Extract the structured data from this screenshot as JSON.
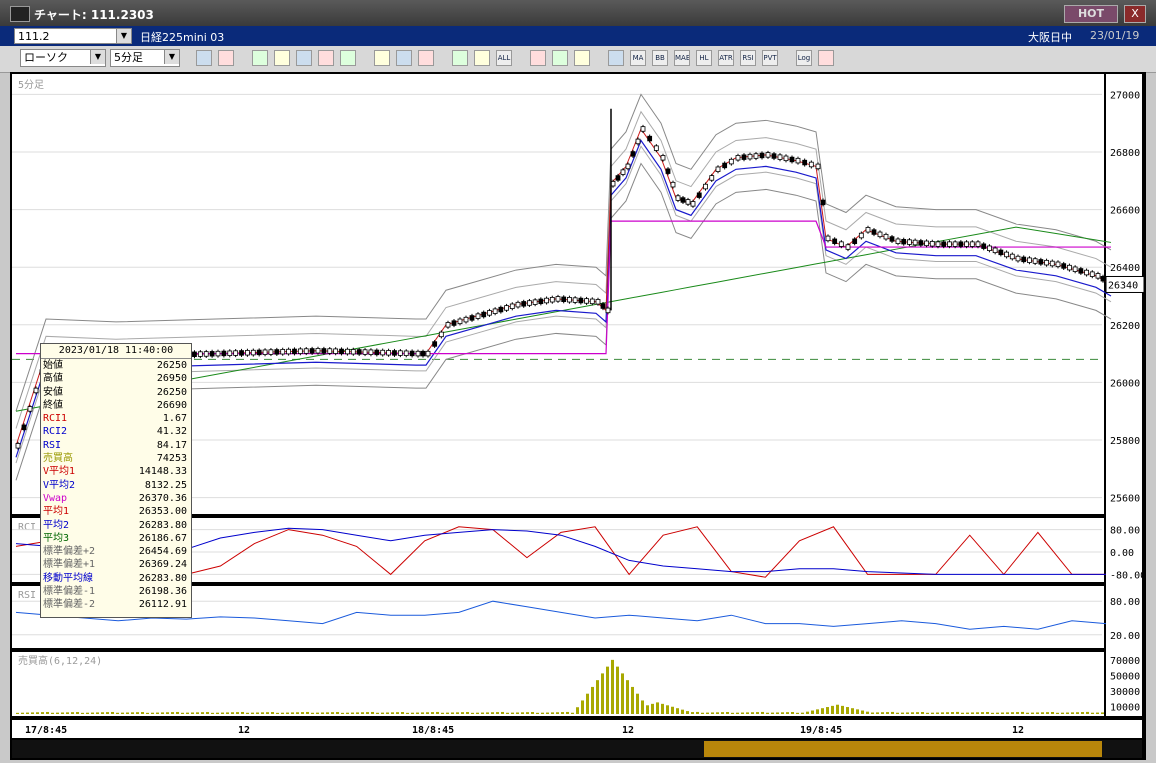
{
  "window": {
    "title": "チャート: 111.2303",
    "hot_label": "HOT",
    "close_label": "X"
  },
  "infobar": {
    "code": "111.2",
    "instrument": "日経225mini 03",
    "session": "大阪日中",
    "date": "23/01/19"
  },
  "toolbar": {
    "chart_type": "ローソク",
    "timeframe": "5分足",
    "buttons": [
      "zoom",
      "split",
      "buy-sell",
      "search",
      "bar",
      "indicator",
      "disabled",
      "draw",
      "cursor",
      "arrow",
      "candle",
      "line",
      "ALL",
      "pattern",
      "tools",
      "color",
      "band",
      "MA",
      "BB",
      "MAE",
      "HL",
      "ATR",
      "RSI",
      "PVT",
      "Log",
      "print"
    ],
    "text_buttons": {
      "MA": "MA",
      "BB": "BB",
      "MAE": "MAE",
      "HL": "HL",
      "ATR": "ATR",
      "RSI": "RSI",
      "PVT": "PVT",
      "Log": "Log",
      "ALL": "ALL"
    }
  },
  "panels": {
    "main_label": "5分足",
    "rci_label": "RCI",
    "rsi_label": "RSI",
    "volume_label": "売買高(6,12,24)"
  },
  "price_axis": {
    "ticks": [
      "27000",
      "26800",
      "26600",
      "26400",
      "26200",
      "26000",
      "25800",
      "25600"
    ],
    "current": "26340"
  },
  "rci_axis": {
    "ticks": [
      "80.00",
      "0.00",
      "-80.00"
    ]
  },
  "rsi_axis": {
    "ticks": [
      "80.00",
      "20.00"
    ]
  },
  "volume_axis": {
    "ticks": [
      "70000",
      "50000",
      "30000",
      "10000"
    ]
  },
  "time_axis": {
    "labels": [
      "17/8:45",
      "12",
      "18/8:45",
      "12",
      "19/8:45",
      "12"
    ]
  },
  "info_panel": {
    "datetime": "2023/01/18 11:40:00",
    "rows": [
      {
        "label": "始値",
        "value": "26250",
        "color": "#000000"
      },
      {
        "label": "高値",
        "value": "26950",
        "color": "#000000"
      },
      {
        "label": "安値",
        "value": "26250",
        "color": "#000000"
      },
      {
        "label": "終値",
        "value": "26690",
        "color": "#000000"
      },
      {
        "label": "RCI1",
        "value": "1.67",
        "color": "#cc0000"
      },
      {
        "label": "RCI2",
        "value": "41.32",
        "color": "#0000cc"
      },
      {
        "label": "RSI",
        "value": "84.17",
        "color": "#0000cc"
      },
      {
        "label": "売買高",
        "value": "74253",
        "color": "#999900"
      },
      {
        "label": "V平均1",
        "value": "14148.33",
        "color": "#cc0000"
      },
      {
        "label": "V平均2",
        "value": "8132.25",
        "color": "#0000cc"
      },
      {
        "label": "Vwap",
        "value": "26370.36",
        "color": "#cc00cc"
      },
      {
        "label": "平均1",
        "value": "26353.00",
        "color": "#cc0000"
      },
      {
        "label": "平均2",
        "value": "26283.80",
        "color": "#0000cc"
      },
      {
        "label": "平均3",
        "value": "26186.67",
        "color": "#006600"
      },
      {
        "label": "標準偏差+2",
        "value": "26454.69",
        "color": "#666666"
      },
      {
        "label": "標準偏差+1",
        "value": "26369.24",
        "color": "#666666"
      },
      {
        "label": "移動平均線",
        "value": "26283.80",
        "color": "#0000cc"
      },
      {
        "label": "標準偏差-1",
        "value": "26198.36",
        "color": "#666666"
      },
      {
        "label": "標準偏差-2",
        "value": "26112.91",
        "color": "#666666"
      }
    ]
  },
  "chart_data": {
    "type": "candlestick",
    "timeframe": "5分足",
    "y_range": [
      25550,
      27050
    ],
    "current_price": 26340,
    "dashed_level": 26080,
    "price_points": [
      [
        0,
        25780
      ],
      [
        30,
        26100
      ],
      [
        100,
        26090
      ],
      [
        200,
        26100
      ],
      [
        300,
        26110
      ],
      [
        400,
        26100
      ],
      [
        410,
        26100
      ],
      [
        430,
        26200
      ],
      [
        460,
        26230
      ],
      [
        500,
        26270
      ],
      [
        540,
        26290
      ],
      [
        580,
        26280
      ],
      [
        590,
        26250
      ],
      [
        595,
        26690
      ],
      [
        610,
        26750
      ],
      [
        625,
        26880
      ],
      [
        645,
        26780
      ],
      [
        660,
        26640
      ],
      [
        675,
        26620
      ],
      [
        700,
        26740
      ],
      [
        720,
        26780
      ],
      [
        750,
        26790
      ],
      [
        780,
        26770
      ],
      [
        800,
        26750
      ],
      [
        810,
        26500
      ],
      [
        830,
        26470
      ],
      [
        850,
        26530
      ],
      [
        880,
        26490
      ],
      [
        920,
        26480
      ],
      [
        960,
        26480
      ],
      [
        1000,
        26430
      ],
      [
        1040,
        26410
      ],
      [
        1080,
        26370
      ],
      [
        1095,
        26340
      ]
    ],
    "rci1": [
      20,
      40,
      70,
      40,
      -60,
      -80,
      -50,
      30,
      80,
      60,
      20,
      -80,
      40,
      90,
      80,
      -20,
      70,
      90,
      -80,
      60,
      90,
      -70,
      -90,
      40,
      90,
      -80,
      -80,
      -80,
      60,
      -80,
      70,
      -80,
      -80
    ],
    "rci2": [
      30,
      20,
      -40,
      -60,
      -40,
      10,
      50,
      70,
      85,
      80,
      60,
      40,
      60,
      70,
      80,
      75,
      60,
      20,
      -30,
      -50,
      -60,
      -70,
      -70,
      -60,
      -60,
      -70,
      -75,
      -80,
      -80,
      -80,
      -80,
      -80,
      -80
    ],
    "rsi": [
      60,
      55,
      50,
      45,
      50,
      48,
      52,
      50,
      45,
      40,
      60,
      55,
      55,
      60,
      80,
      70,
      60,
      50,
      55,
      50,
      45,
      55,
      40,
      40,
      35,
      40,
      45,
      40,
      30,
      35,
      30,
      45,
      40
    ],
    "volume_spikes": [
      [
        595,
        70000
      ],
      [
        640,
        15000
      ],
      [
        820,
        12000
      ]
    ]
  }
}
